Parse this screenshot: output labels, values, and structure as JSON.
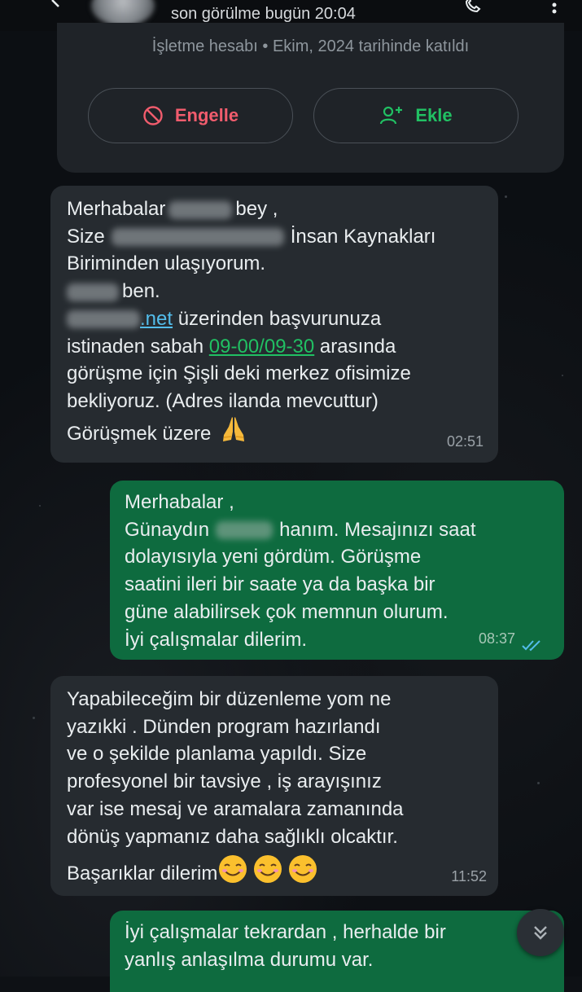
{
  "header": {
    "last_seen": "son görülme bugün 20:04"
  },
  "contact_card": {
    "business_info": "İşletme hesabı • Ekim, 2024 tarihinde katıldı",
    "block_label": "Engelle",
    "add_label": "Ekle"
  },
  "messages": [
    {
      "direction": "incoming",
      "lines": [
        [
          "Merhabalar",
          "bey ,"
        ],
        [
          "Size",
          "İnsan Kaynakları"
        ],
        [
          "Biriminden ulaşıyorum."
        ],
        [
          "ben."
        ],
        [
          ".net",
          " üzerinden başvurunuza"
        ],
        [
          "istinaden sabah ",
          "09-00/09-30",
          " arasında"
        ],
        [
          "görüşme için Şişli deki merkez ofisimize"
        ],
        [
          "bekliyoruz. (Adres ilanda mevcuttur)"
        ],
        [
          "Görüşmek üzere"
        ]
      ],
      "time": "02:51"
    },
    {
      "direction": "outgoing",
      "lines": [
        [
          "Merhabalar ,"
        ],
        [
          "Günaydın",
          "hanım. Mesajınızı saat"
        ],
        [
          "dolayısıyla yeni gördüm. Görüşme"
        ],
        [
          "saatini ileri bir saate ya da başka bir"
        ],
        [
          "güne alabilirsek çok memnun olurum."
        ],
        [
          "İyi çalışmalar dilerim."
        ]
      ],
      "time": "08:37"
    },
    {
      "direction": "incoming",
      "lines": [
        [
          "Yapabileceğim bir düzenleme yom ne"
        ],
        [
          "yazıkki . Dünden program hazırlandı"
        ],
        [
          "ve o şekilde planlama yapıldı. Size"
        ],
        [
          "profesyonel bir tavsiye , iş arayışınız"
        ],
        [
          "var ise mesaj ve aramalara zamanında"
        ],
        [
          "dönüş yapmanız daha sağlıklı olcaktır."
        ],
        [
          "Başarıklar dilerim"
        ]
      ],
      "time": "11:52"
    },
    {
      "direction": "outgoing",
      "lines": [
        [
          "İyi çalışmalar tekrardan , herhalde bir"
        ],
        [
          "yanlış anlaşılma durumu var."
        ]
      ]
    }
  ],
  "colors": {
    "incoming_bubble": "#262b30",
    "outgoing_bubble": "#0e6b3f",
    "link": "#53bdeb",
    "block_red": "#f15c6d",
    "add_green": "#21c063",
    "read_ticks": "#53bdeb"
  },
  "icons": [
    "back-arrow-icon",
    "avatar",
    "call-icon",
    "more-options-icon",
    "block-icon",
    "add-contact-icon",
    "pray-emoji",
    "smiling-face-emoji",
    "double-check-icon",
    "chevron-double-down-icon"
  ]
}
